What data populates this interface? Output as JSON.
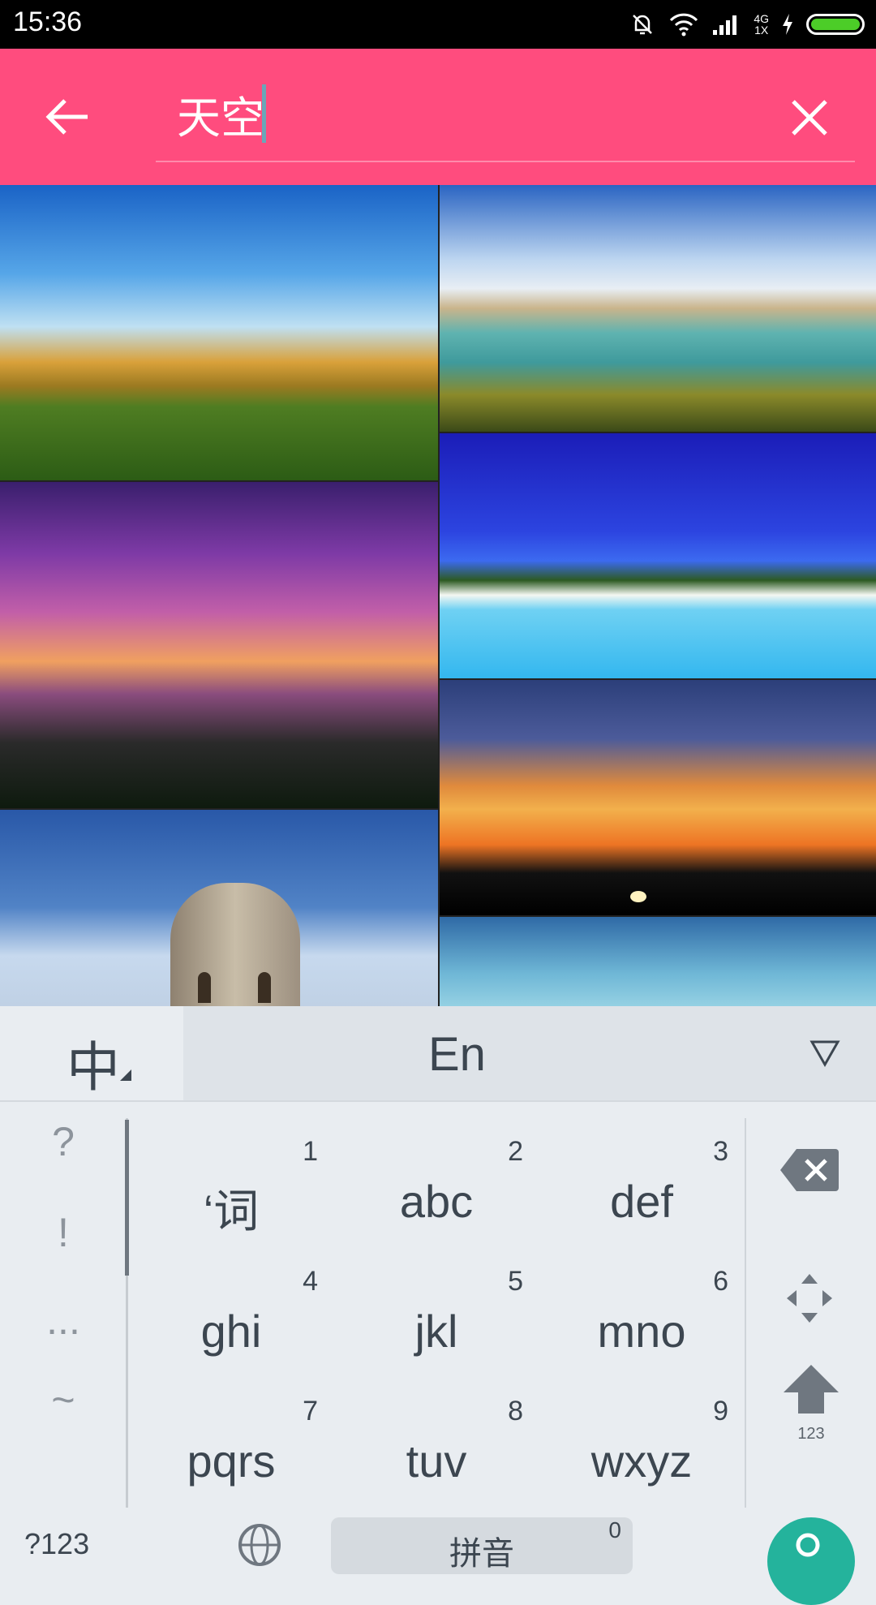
{
  "status_bar": {
    "time": "15:36",
    "network_label_top": "4G",
    "network_label_bottom": "1X",
    "battery_color": "#4ccd28",
    "icons": [
      "mute-alarm-icon",
      "wifi-icon",
      "signal-icon",
      "charging-icon",
      "battery-icon"
    ]
  },
  "search_bar": {
    "query": "天空",
    "accent_color": "#ff4c7e",
    "back_icon": "arrow-left-icon",
    "clear_icon": "close-icon"
  },
  "image_results": [
    {
      "name": "grassland-sky"
    },
    {
      "name": "lake-mountains-clouds"
    },
    {
      "name": "purple-sunset-trees"
    },
    {
      "name": "beach-blue-sky"
    },
    {
      "name": "orange-sunset-clouds"
    },
    {
      "name": "tower-blue-sky"
    },
    {
      "name": "blue-sky-clouds"
    }
  ],
  "keyboard": {
    "mode_zh": "中",
    "mode_en": "En",
    "side_symbols": [
      "?",
      "!",
      "...",
      "~"
    ],
    "keys": [
      {
        "label": "‘词",
        "num": "1"
      },
      {
        "label": "abc",
        "num": "2"
      },
      {
        "label": "def",
        "num": "3"
      },
      {
        "label": "ghi",
        "num": "4"
      },
      {
        "label": "jkl",
        "num": "5"
      },
      {
        "label": "mno",
        "num": "6"
      },
      {
        "label": "pqrs",
        "num": "7"
      },
      {
        "label": "tuv",
        "num": "8"
      },
      {
        "label": "wxyz",
        "num": "9"
      }
    ],
    "shift_sub": "123",
    "bottom_left": "?123",
    "space_label": "拼音",
    "space_num": "0",
    "search_color": "#24b39c"
  }
}
